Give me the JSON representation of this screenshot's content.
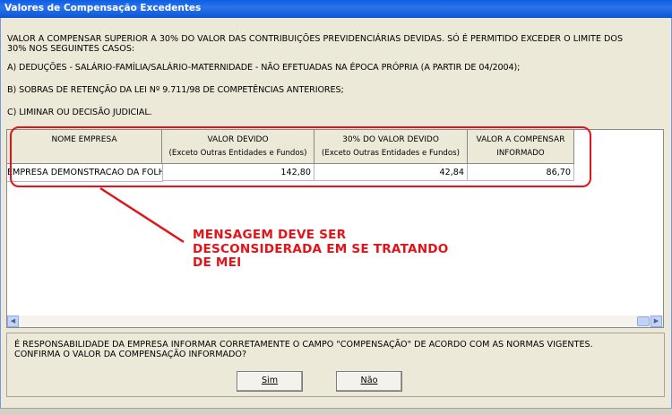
{
  "window": {
    "title": "Valores de Compensação Excedentes"
  },
  "intro": {
    "line1": "VALOR A COMPENSAR SUPERIOR A 30% DO VALOR DAS CONTRIBUIÇÕES PREVIDENCIÁRIAS DEVIDAS. SÓ É PERMITIDO EXCEDER O LIMITE DOS",
    "line2": "30% NOS SEGUINTES CASOS:",
    "item_a": "A) DEDUÇÕES - SALÁRIO-FAMÍLIA/SALÁRIO-MATERNIDADE - NÃO EFETUADAS NA ÉPOCA PRÓPRIA (A PARTIR DE 04/2004);",
    "item_b": "B) SOBRAS DE RETENÇÃO DA LEI Nº 9.711/98 DE COMPETÊNCIAS ANTERIORES;",
    "item_c": "C) LIMINAR OU DECISÃO JUDICIAL."
  },
  "table": {
    "headers": [
      {
        "line1": "NOME EMPRESA",
        "line2": ""
      },
      {
        "line1": "VALOR DEVIDO",
        "line2": "(Exceto Outras Entidades e Fundos)"
      },
      {
        "line1": "30% DO VALOR DEVIDO",
        "line2": "(Exceto Outras Entidades e Fundos)"
      },
      {
        "line1": "VALOR A COMPENSAR",
        "line2": "INFORMADO"
      }
    ],
    "rows": [
      {
        "nome": "EMPRESA DEMONSTRACAO DA FOLHA",
        "valor_devido": "142,80",
        "trinta": "42,84",
        "compensar": "86,70"
      }
    ]
  },
  "annotation": {
    "text": "MENSAGEM DEVE SER\nDESCONSIDERADA EM SE TRATANDO\nDE MEI",
    "color": "#e2131a"
  },
  "footer": {
    "line1": "É RESPONSABILIDADE DA EMPRESA INFORMAR CORRETAMENTE O CAMPO \"COMPENSAÇÃO\" DE ACORDO COM AS NORMAS VIGENTES.",
    "line2": "CONFIRMA O VALOR DA COMPENSAÇÃO INFORMADO?",
    "yes_label": "Sim",
    "no_label": "Não"
  }
}
